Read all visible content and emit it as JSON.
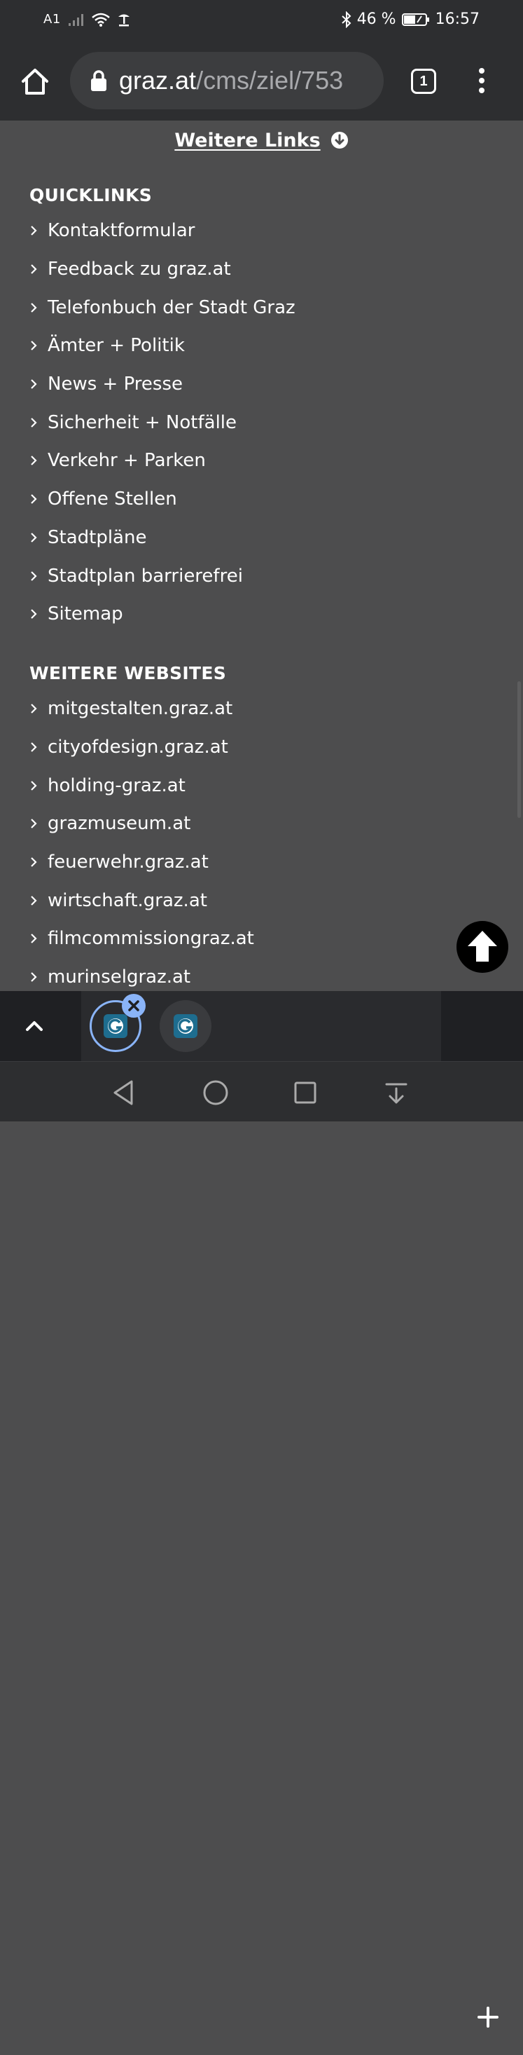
{
  "status_bar": {
    "carrier": "A1",
    "battery": "46 %",
    "time": "16:57"
  },
  "browser": {
    "url_domain": "graz.at",
    "url_path": "/cms/ziel/753",
    "tab_count": "1"
  },
  "more_links": {
    "label": "Weitere Links"
  },
  "quicklinks": {
    "title": "QUICKLINKS",
    "items": [
      "Kontaktformular",
      "Feedback zu graz.at",
      "Telefonbuch der Stadt Graz",
      "Ämter + Politik",
      "News + Presse",
      "Sicherheit + Notfälle",
      "Verkehr + Parken",
      "Offene Stellen",
      "Stadtpläne",
      "Stadtplan barrierefrei",
      "Sitemap"
    ]
  },
  "websites": {
    "title": "WEITERE WEBSITES",
    "items": [
      "mitgestalten.graz.at",
      "cityofdesign.graz.at",
      "holding-graz.at",
      "grazmuseum.at",
      "feuerwehr.graz.at",
      "wirtschaft.graz.at",
      "filmcommissiongraz.at",
      "murinselgraz.at"
    ]
  },
  "colors": {
    "page_background": "#4d4d4e",
    "toolbar_background": "#2d2e30",
    "accent": "#8ab4f8"
  },
  "icons": {
    "home": "home-icon",
    "lock": "lock-icon",
    "menu": "more-vert-icon",
    "scroll_top": "arrow-up-icon",
    "new_tab": "plus-icon"
  }
}
